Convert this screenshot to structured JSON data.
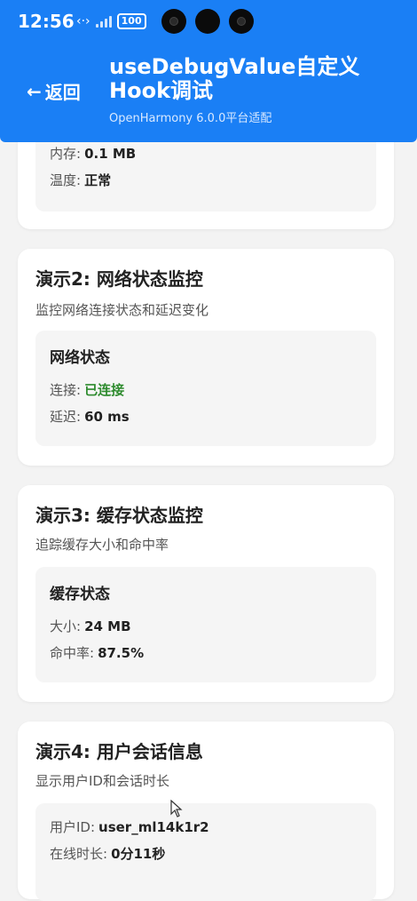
{
  "status_bar": {
    "time": "12:56",
    "icons_text": "‹·›",
    "battery": "100"
  },
  "header": {
    "back_label": "返回",
    "title": "useDebugValue自定义Hook调试",
    "subtitle": "OpenHarmony 6.0.0平台适配"
  },
  "colors": {
    "header_bg": "#1a7ff5",
    "connected_green": "#2e8b2e"
  },
  "card1": {
    "rows": [
      {
        "label": "内存:",
        "value": "0.1 MB"
      },
      {
        "label": "温度:",
        "value": "正常"
      }
    ]
  },
  "card2": {
    "title": "演示2: 网络状态监控",
    "desc": "监控网络连接状态和延迟变化",
    "inner_title": "网络状态",
    "rows": [
      {
        "label": "连接:",
        "value": "已连接"
      },
      {
        "label": "延迟:",
        "value": "60 ms"
      }
    ]
  },
  "card3": {
    "title": "演示3: 缓存状态监控",
    "desc": "追踪缓存大小和命中率",
    "inner_title": "缓存状态",
    "rows": [
      {
        "label": "大小:",
        "value": "24 MB"
      },
      {
        "label": "命中率:",
        "value": "87.5%"
      }
    ]
  },
  "card4": {
    "title": "演示4: 用户会话信息",
    "desc": "显示用户ID和会话时长",
    "rows": [
      {
        "label": "用户ID:",
        "value": "user_ml14k1r2"
      },
      {
        "label": "在线时长:",
        "value": "0分11秒"
      }
    ]
  }
}
